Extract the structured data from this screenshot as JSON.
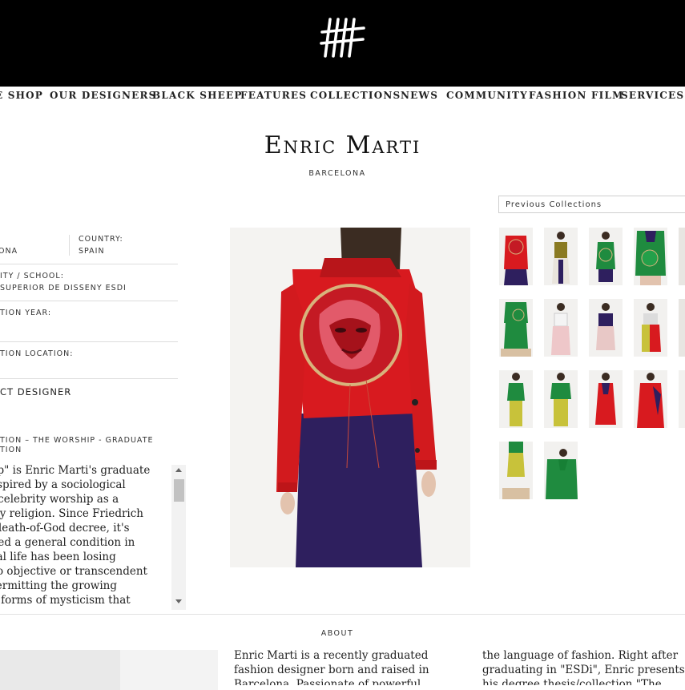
{
  "nav": {
    "items": [
      "E SHOP",
      "OUR DESIGNERS",
      "BLACK SHEEP",
      "FEATURES",
      "COLLECTIONS",
      "NEWS",
      "COMMUNITY",
      "FASHION FILM",
      "SERVICES"
    ]
  },
  "designer": {
    "name": "Enric Marti",
    "city": "BARCELONA"
  },
  "info": {
    "city_value": "ONA",
    "country_label": "COUNTRY:",
    "country_value": "SPAIN",
    "university_label": "ITY / SCHOOL:",
    "university_value": "SUPERIOR DE DISSENY ESDI",
    "graduation_year_label": "TION YEAR:",
    "graduation_location_label": "TION LOCATION:",
    "designer_type": "CT DESIGNER",
    "collection_title_line1": "TION – THE WORSHIP - GRADUATE",
    "collection_title_line2": "TION"
  },
  "description": {
    "lines": [
      "orship\" is Enric Marti's graduate",
      "on inspired by a sociological",
      "bout celebrity worship as a",
      "porary religion. Since Friedrich",
      "he's death-of-God decree, it's",
      "entified a general condition in",
      "ultural life has been losing",
      "nce to objective or transcendent",
      "ds, permitting the growing",
      "ity of forms of mysticism that"
    ]
  },
  "collections_select": {
    "label": "Previous Collections"
  },
  "about": {
    "label": "ABOUT",
    "col1": "Enric Marti is a recently graduated fashion designer born and raised in Barcelona. Passionate of powerful colors and shaping",
    "col2": "the language of fashion. Right after graduating in \"ESDi\", Enric presents his degree thesis/collection \"The Worship\" in"
  },
  "colors": {
    "red": "#d81a1f",
    "navy": "#2e1f5e",
    "green": "#1f8b3f",
    "yellow": "#c8c23a"
  },
  "icons": {
    "logo": "tally-marks-logo"
  }
}
